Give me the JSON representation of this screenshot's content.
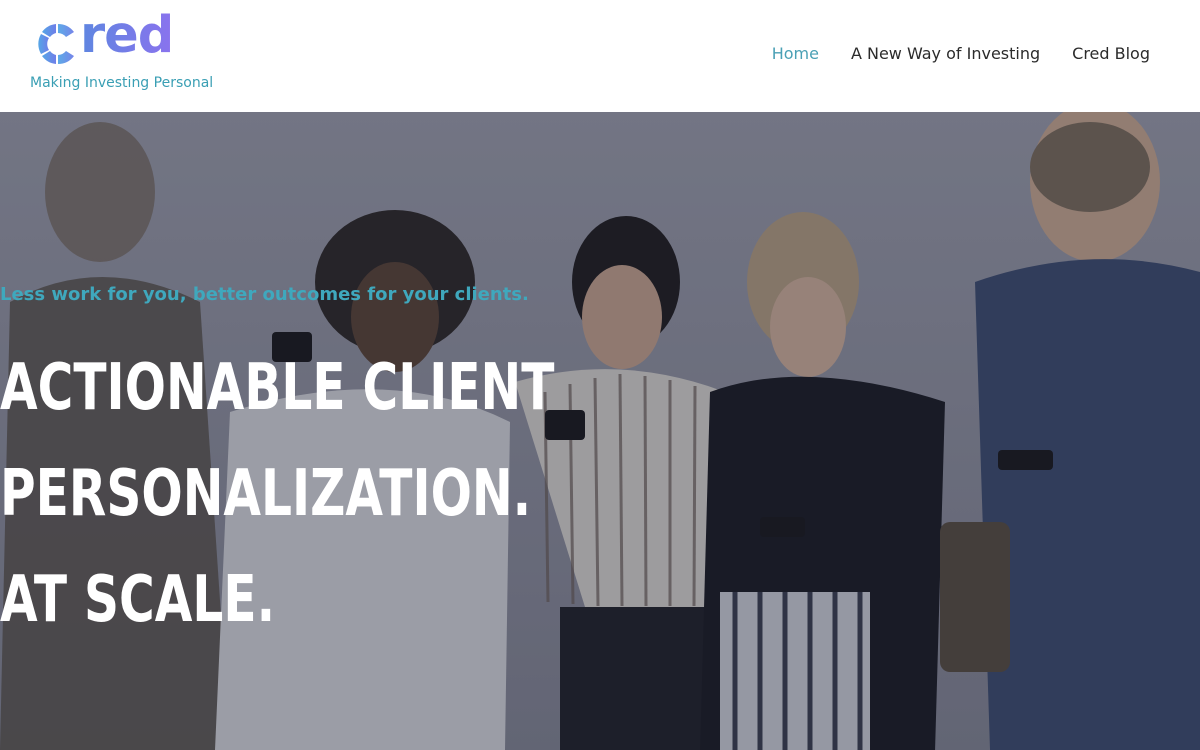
{
  "header": {
    "brand": {
      "name": "Cred",
      "word": "red",
      "tagline": "Making Investing Personal",
      "icon": "segmented-ring-logo-icon",
      "colors": {
        "gradient_start": "#5e86e0",
        "gradient_end": "#8a73ee",
        "tagline": "#3a9fb4"
      }
    },
    "nav": [
      {
        "label": "Home",
        "active": true
      },
      {
        "label": "A New Way of Investing",
        "active": false
      },
      {
        "label": "Cred Blog",
        "active": false
      }
    ],
    "colors": {
      "active_link": "#4aa0b5",
      "link": "#2b2b2b"
    }
  },
  "hero": {
    "kicker": "Less work for you, better outcomes for your clients.",
    "headline": [
      "Actionable Client",
      "Personalization.",
      "At Scale."
    ],
    "image": "group-of-people-looking-at-phones-photo",
    "colors": {
      "kicker": "#3fa8bd",
      "headline": "#ffffff"
    }
  }
}
